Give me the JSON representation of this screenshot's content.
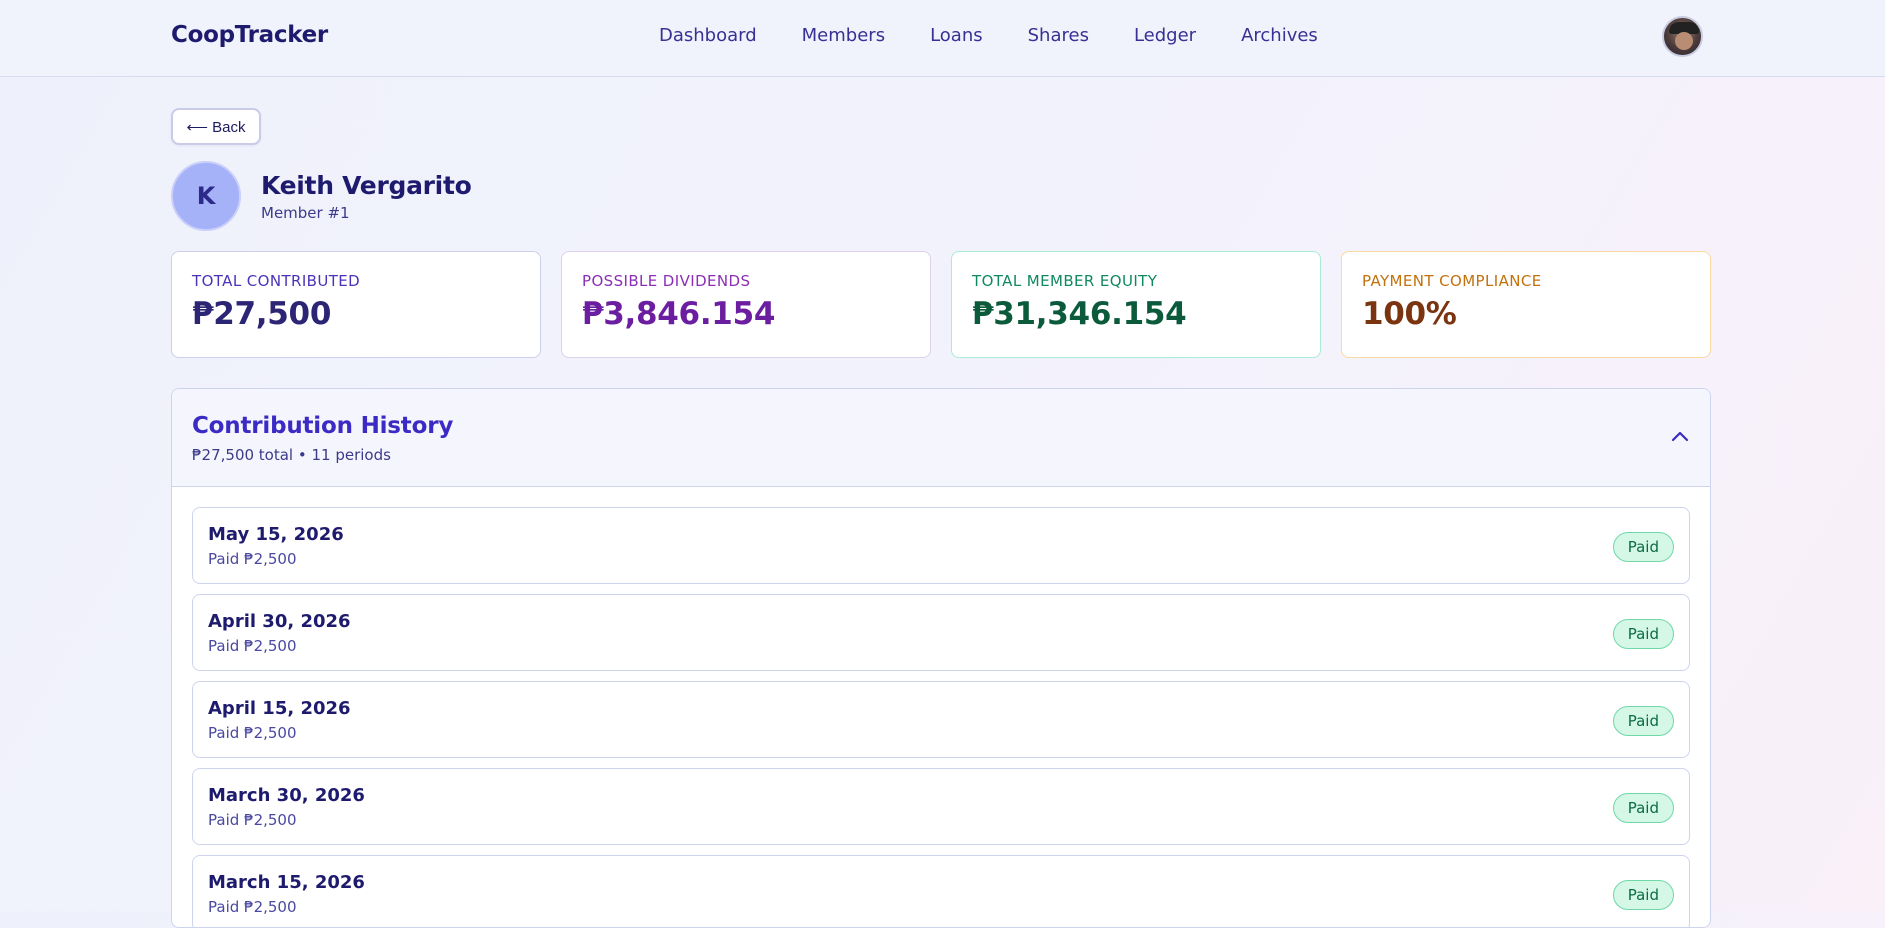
{
  "app": {
    "brand": "CoopTracker"
  },
  "nav": {
    "links": [
      "Dashboard",
      "Members",
      "Loans",
      "Shares",
      "Ledger",
      "Archives"
    ]
  },
  "back_label": "⟵ Back",
  "member": {
    "initial": "K",
    "name": "Keith Vergarito",
    "number": "Member #1"
  },
  "stats": [
    {
      "label": "TOTAL CONTRIBUTED",
      "value": "₱27,500"
    },
    {
      "label": "POSSIBLE DIVIDENDS",
      "value": "₱3,846.154"
    },
    {
      "label": "TOTAL MEMBER EQUITY",
      "value": "₱31,346.154"
    },
    {
      "label": "PAYMENT COMPLIANCE",
      "value": "100%"
    }
  ],
  "history": {
    "title": "Contribution History",
    "summary": "₱27,500 total • 11 periods",
    "expanded": true,
    "rows": [
      {
        "date": "May 15, 2026",
        "amount": "Paid ₱2,500",
        "status": "Paid"
      },
      {
        "date": "April 30, 2026",
        "amount": "Paid ₱2,500",
        "status": "Paid"
      },
      {
        "date": "April 15, 2026",
        "amount": "Paid ₱2,500",
        "status": "Paid"
      },
      {
        "date": "March 30, 2026",
        "amount": "Paid ₱2,500",
        "status": "Paid"
      },
      {
        "date": "March 15, 2026",
        "amount": "Paid ₱2,500",
        "status": "Paid"
      }
    ]
  },
  "colors": {
    "accent": "#3b2bc4",
    "dividends": "#6b1ea0",
    "equity": "#0b5a3c",
    "compliance": "#7a3410",
    "paid_badge": "#d4f7e6"
  },
  "icons": {
    "collapse": "chevron-up-icon",
    "avatar": "user-avatar"
  }
}
